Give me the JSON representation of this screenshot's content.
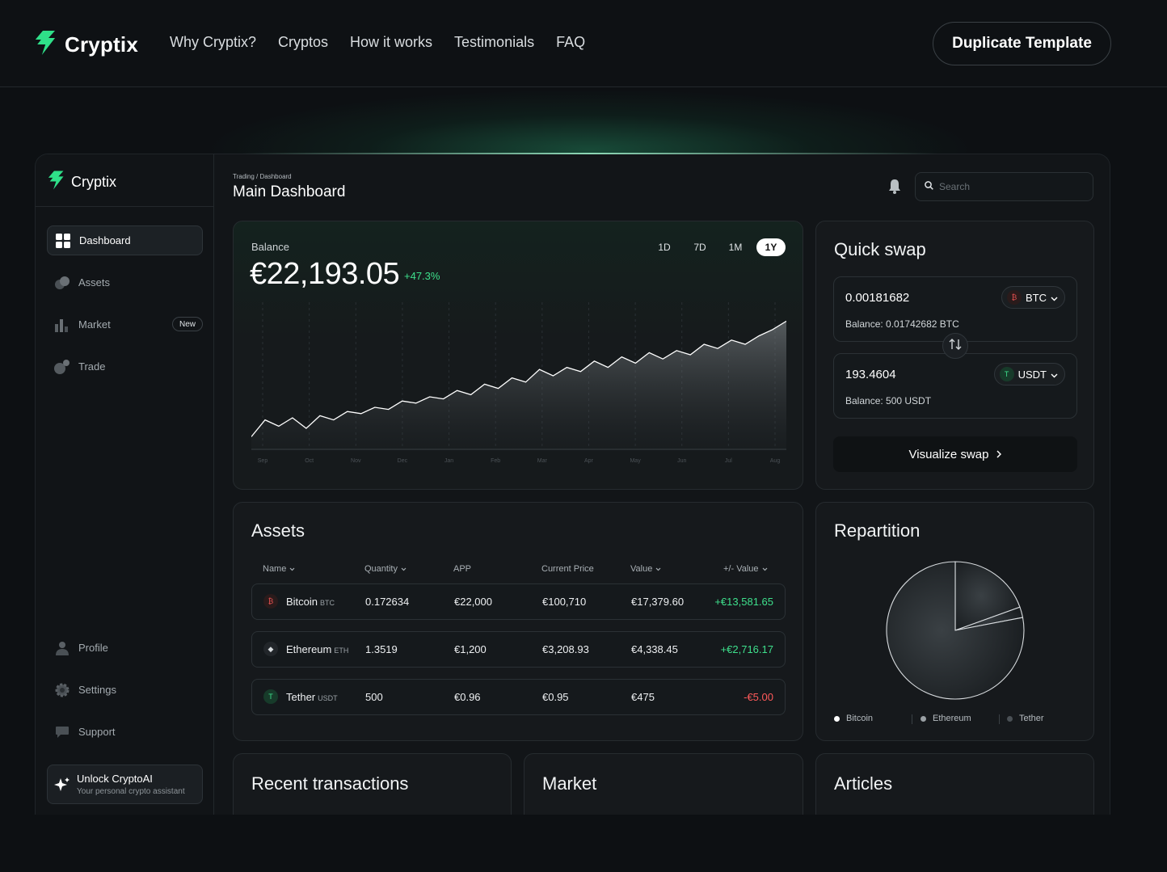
{
  "site": {
    "brand": "Cryptix",
    "nav": [
      "Why Cryptix?",
      "Cryptos",
      "How it works",
      "Testimonials",
      "FAQ"
    ],
    "cta": "Duplicate Template"
  },
  "sidebar": {
    "brand": "Cryptix",
    "items": [
      {
        "label": "Dashboard",
        "icon": "grid-icon",
        "active": true
      },
      {
        "label": "Assets",
        "icon": "coins-icon"
      },
      {
        "label": "Market",
        "icon": "bar-chart-icon",
        "badge": "New"
      },
      {
        "label": "Trade",
        "icon": "trade-icon"
      }
    ],
    "bottom_items": [
      {
        "label": "Profile",
        "icon": "user-icon"
      },
      {
        "label": "Settings",
        "icon": "gear-icon"
      },
      {
        "label": "Support",
        "icon": "chat-icon"
      }
    ],
    "unlock": {
      "title": "Unlock CryptoAI",
      "subtitle": "Your personal crypto assistant"
    }
  },
  "header": {
    "breadcrumb": "Trading / Dashboard",
    "title": "Main Dashboard",
    "search_placeholder": "Search"
  },
  "balance": {
    "label": "Balance",
    "value": "€22,193.05",
    "change": "+47.3%",
    "periods": [
      "1D",
      "7D",
      "1M",
      "1Y"
    ],
    "active_period": "1Y"
  },
  "chart_data": {
    "type": "area",
    "x": [
      "Sep",
      "Oct",
      "Nov",
      "Dec",
      "Jan",
      "Feb",
      "Mar",
      "Apr",
      "May",
      "Jun",
      "Jul",
      "Aug"
    ],
    "values": [
      12,
      28,
      22,
      30,
      20,
      32,
      28,
      36,
      34,
      40,
      38,
      46,
      44,
      50,
      48,
      56,
      52,
      62,
      58,
      68,
      64,
      76,
      70,
      78,
      74,
      84,
      78,
      88,
      82,
      92,
      86,
      94,
      90,
      100,
      96,
      104,
      100,
      108,
      114,
      122
    ],
    "ylim": [
      0,
      140
    ],
    "grid": "vertical",
    "accent": "#ffffff"
  },
  "swap": {
    "title": "Quick swap",
    "from": {
      "amount": "0.00181682",
      "token": "BTC",
      "balance": "Balance: 0.01742682 BTC"
    },
    "to": {
      "amount": "193.4604",
      "token": "USDT",
      "balance": "Balance: 500 USDT"
    },
    "button": "Visualize swap"
  },
  "assets": {
    "title": "Assets",
    "columns": [
      "Name",
      "Quantity",
      "APP",
      "Current Price",
      "Value",
      "+/- Value"
    ],
    "rows": [
      {
        "name": "Bitcoin",
        "symbol": "BTC",
        "coin": "btc",
        "quantity": "0.172634",
        "app": "€22,000",
        "price": "€100,710",
        "value": "€17,379.60",
        "delta": "+€13,581.65",
        "positive": true
      },
      {
        "name": "Ethereum",
        "symbol": "ETH",
        "coin": "eth",
        "quantity": "1.3519",
        "app": "€1,200",
        "price": "€3,208.93",
        "value": "€4,338.45",
        "delta": "+€2,716.17",
        "positive": true
      },
      {
        "name": "Tether",
        "symbol": "USDT",
        "coin": "usdt",
        "quantity": "500",
        "app": "€0.96",
        "price": "€0.95",
        "value": "€475",
        "delta": "-€5.00",
        "positive": false
      }
    ]
  },
  "repartition": {
    "title": "Repartition",
    "slices": [
      {
        "name": "Bitcoin",
        "value": 78,
        "color": "#ffffff"
      },
      {
        "name": "Ethereum",
        "value": 19.5,
        "color": "#9aa0a4"
      },
      {
        "name": "Tether",
        "value": 2.5,
        "color": "#4a5055"
      }
    ]
  },
  "bottom_cards": [
    "Recent transactions",
    "Market",
    "Articles"
  ],
  "colors": {
    "accent_green": "#3ee08c",
    "negative": "#ff5a5a",
    "background": "#0d1013"
  }
}
